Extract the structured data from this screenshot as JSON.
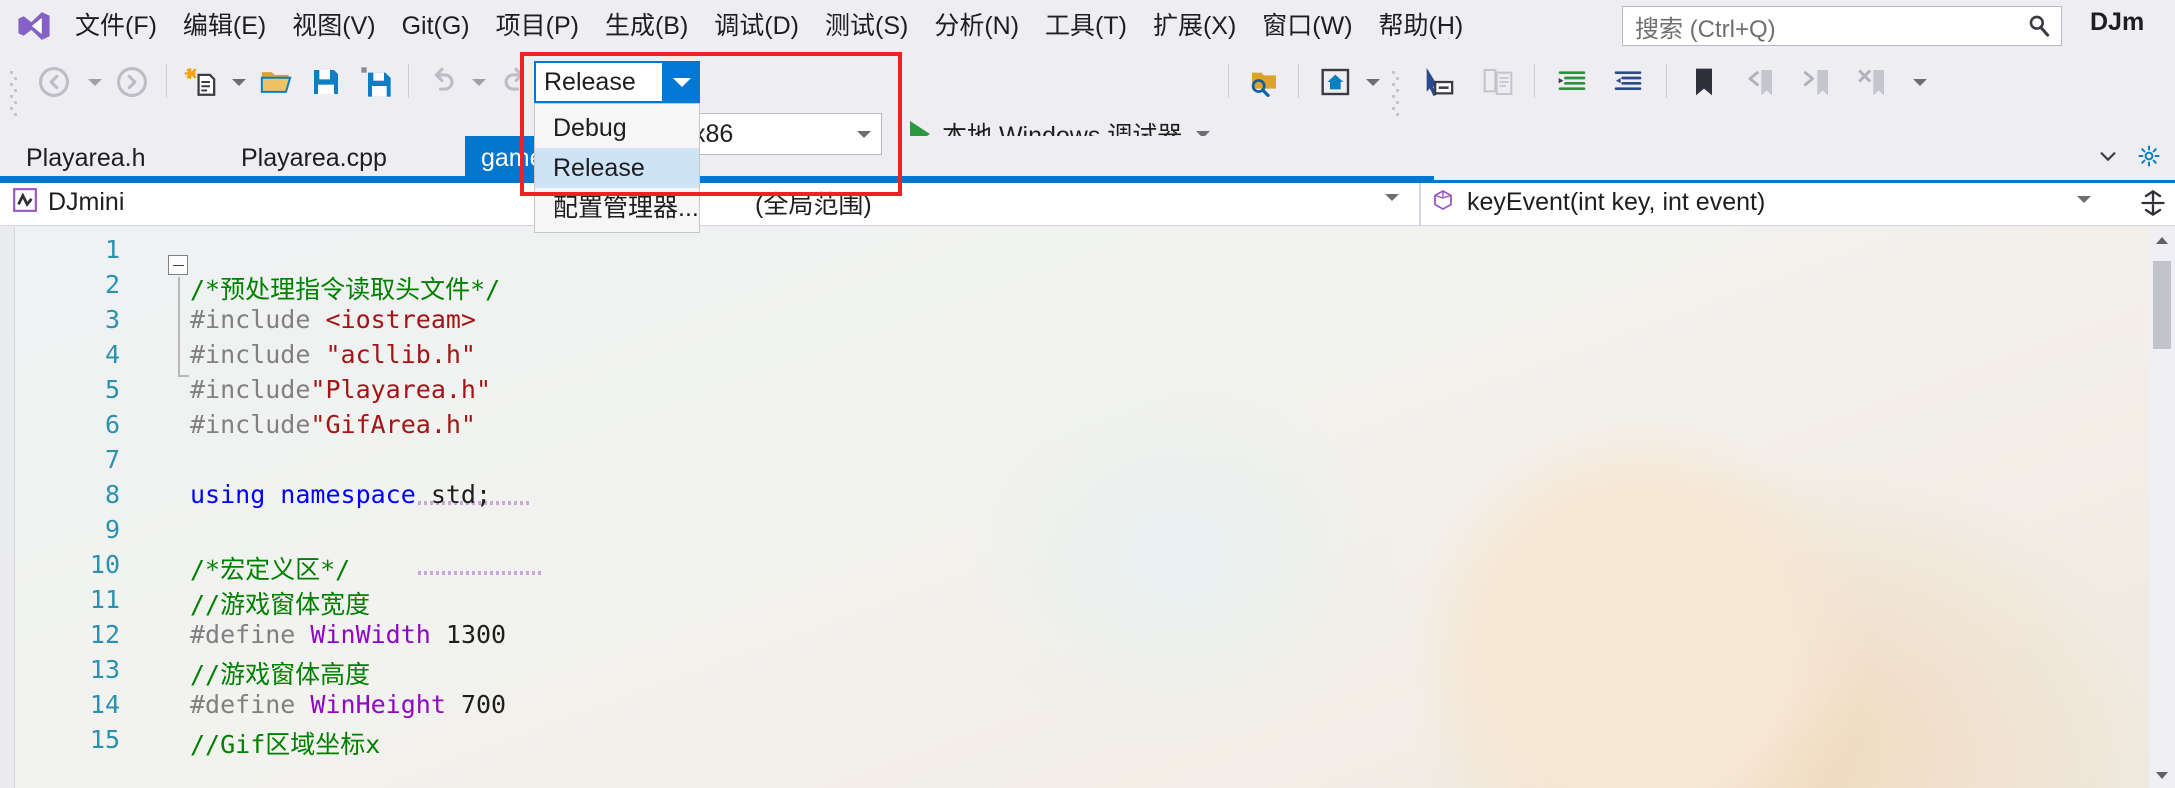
{
  "app": {
    "logo_icon": "visual-studio-logo",
    "account_name": "DJm"
  },
  "menubar": {
    "items": [
      {
        "label": "文件(F)"
      },
      {
        "label": "编辑(E)"
      },
      {
        "label": "视图(V)"
      },
      {
        "label": "Git(G)"
      },
      {
        "label": "项目(P)"
      },
      {
        "label": "生成(B)"
      },
      {
        "label": "调试(D)"
      },
      {
        "label": "测试(S)"
      },
      {
        "label": "分析(N)"
      },
      {
        "label": "工具(T)"
      },
      {
        "label": "扩展(X)"
      },
      {
        "label": "窗口(W)"
      },
      {
        "label": "帮助(H)"
      }
    ]
  },
  "search": {
    "placeholder": "搜索 (Ctrl+Q)",
    "value": "搜索 (Ctrl+Q)",
    "icon": "search-icon"
  },
  "toolbar": {
    "navigate_back_icon": "arrow-left-icon",
    "navigate_forward_icon": "arrow-right-icon",
    "new_item_icon": "new-item-icon",
    "open_file_icon": "open-folder-icon",
    "save_icon": "save-icon",
    "save_all_icon": "save-all-icon",
    "undo_icon": "undo-icon",
    "redo_icon": "redo-icon",
    "find_in_files_icon": "find-in-files-icon",
    "home_icon": "home-icon",
    "pointer_icon": "pointer-select-icon",
    "compare_icon": "compare-files-icon",
    "indent_icon": "increase-indent-icon",
    "outdent_icon": "decrease-indent-icon",
    "bookmark_icon": "bookmark-icon",
    "prev_bookmark_icon": "previous-bookmark-icon",
    "next_bookmark_icon": "next-bookmark-icon",
    "clear_bookmarks_icon": "clear-bookmarks-icon",
    "overflow_icon": "toolbar-overflow-icon"
  },
  "config_combo": {
    "value": "Release",
    "dropdown_arrow_icon": "chevron-down-icon",
    "is_open": true,
    "options": [
      {
        "label": "Debug",
        "selected": false
      },
      {
        "label": "Release",
        "selected": true
      },
      {
        "label": "配置管理器...",
        "selected": false
      }
    ],
    "highlight_color": "#ee2222"
  },
  "platform_combo": {
    "value": "x86",
    "dropdown_arrow_icon": "chevron-down-icon"
  },
  "run": {
    "label": "本地 Windows 调试器",
    "play_icon": "play-triangle-icon",
    "caret_icon": "chevron-down-icon",
    "accent_color": "#2b9a3f"
  },
  "tabs": {
    "items": [
      {
        "label": "Playarea.h",
        "active": false
      },
      {
        "label": "Playarea.cpp",
        "active": false
      },
      {
        "label": "game",
        "active": true
      }
    ],
    "active_color": "#0277cd",
    "chevron_icon": "chevron-down-icon",
    "settings_icon": "gear-icon"
  },
  "navbar": {
    "project_icon": "project-icon",
    "project": "DJmini",
    "scope": "(全局范围)",
    "function_icon": "method-icon",
    "function": "keyEvent(int key, int event)",
    "project_caret_icon": "chevron-down-icon",
    "function_caret_icon": "chevron-down-icon",
    "split_icon": "split-window-icon"
  },
  "editor": {
    "lines": [
      {
        "n": "1",
        "tokens": []
      },
      {
        "n": "2",
        "tokens": [
          {
            "t": "/*预处理指令读取头文件*/",
            "c": "c-comment"
          }
        ]
      },
      {
        "n": "3",
        "tokens": [
          {
            "t": "#include ",
            "c": "c-pre"
          },
          {
            "t": "<iostream>",
            "c": "c-str"
          }
        ]
      },
      {
        "n": "4",
        "tokens": [
          {
            "t": "#include ",
            "c": "c-pre"
          },
          {
            "t": "\"acllib.h\"",
            "c": "c-str"
          }
        ]
      },
      {
        "n": "5",
        "tokens": [
          {
            "t": "#include",
            "c": "c-pre"
          },
          {
            "t": "\"Playarea.h\"",
            "c": "c-str"
          }
        ]
      },
      {
        "n": "6",
        "tokens": [
          {
            "t": "#include",
            "c": "c-pre"
          },
          {
            "t": "\"GifArea.h\"",
            "c": "c-str"
          }
        ]
      },
      {
        "n": "7",
        "tokens": []
      },
      {
        "n": "8",
        "tokens": [
          {
            "t": "using namespace",
            "c": "c-kw"
          },
          {
            "t": " std;",
            "c": "c-txt"
          }
        ]
      },
      {
        "n": "9",
        "tokens": []
      },
      {
        "n": "10",
        "tokens": [
          {
            "t": "/*宏定义区*/",
            "c": "c-comment"
          }
        ]
      },
      {
        "n": "11",
        "tokens": [
          {
            "t": "//游戏窗体宽度",
            "c": "c-comment"
          }
        ]
      },
      {
        "n": "12",
        "tokens": [
          {
            "t": "#define ",
            "c": "c-pre"
          },
          {
            "t": "WinWidth",
            "c": "c-macro"
          },
          {
            "t": " 1300",
            "c": "c-num"
          }
        ]
      },
      {
        "n": "13",
        "tokens": [
          {
            "t": "//游戏窗体高度",
            "c": "c-comment"
          }
        ]
      },
      {
        "n": "14",
        "tokens": [
          {
            "t": "#define ",
            "c": "c-pre"
          },
          {
            "t": "WinHeight",
            "c": "c-macro"
          },
          {
            "t": " 700",
            "c": "c-num"
          }
        ]
      },
      {
        "n": "15",
        "tokens": [
          {
            "t": "//Gif区域坐标x",
            "c": "c-comment"
          }
        ]
      }
    ],
    "fold_icon": "collapse-region-icon"
  },
  "scrollbar": {
    "up_icon": "scroll-up-icon",
    "down_icon": "scroll-down-icon",
    "thumb": "scroll-thumb"
  }
}
